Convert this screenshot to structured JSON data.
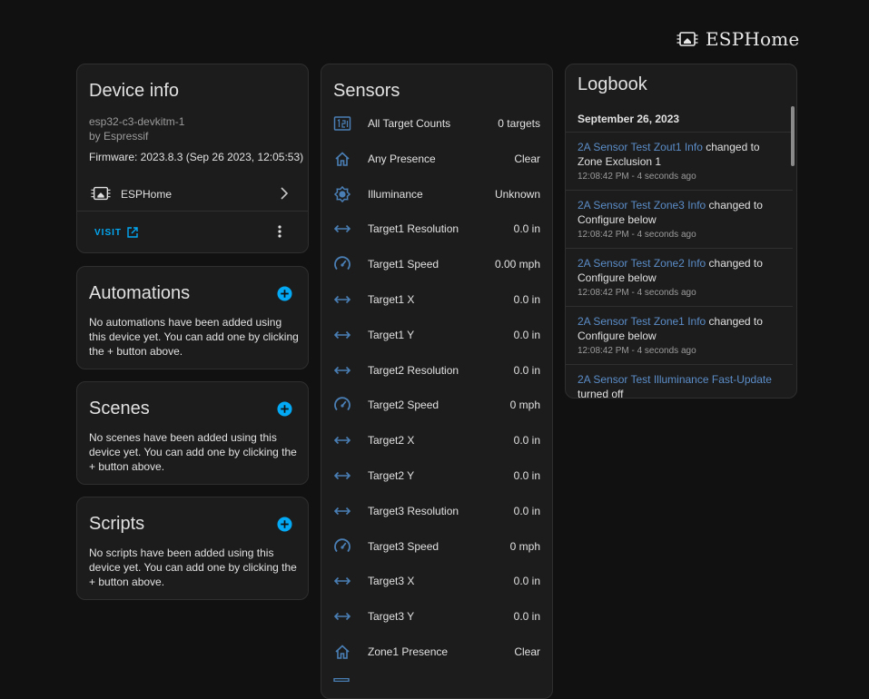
{
  "brand": {
    "name": "ESPHome"
  },
  "device_info": {
    "title": "Device info",
    "model": "esp32-c3-devkitm-1",
    "manufacturer": "by Espressif",
    "firmware": "Firmware: 2023.8.3 (Sep 26 2023, 12:05:53)",
    "integration": "ESPHome",
    "visit_label": "VISIT"
  },
  "automations": {
    "title": "Automations",
    "description": "No automations have been added using this device yet. You can add one by clicking the + button above."
  },
  "scenes": {
    "title": "Scenes",
    "description": "No scenes have been added using this device yet. You can add one by clicking the + button above."
  },
  "scripts": {
    "title": "Scripts",
    "description": "No scripts have been added using this device yet. You can add one by clicking the + button above."
  },
  "sensors": {
    "title": "Sensors",
    "items": [
      {
        "name": "All Target Counts",
        "value": "0 targets",
        "icon": "counter-icon"
      },
      {
        "name": "Any Presence",
        "value": "Clear",
        "icon": "home-icon"
      },
      {
        "name": "Illuminance",
        "value": "Unknown",
        "icon": "brightness-icon"
      },
      {
        "name": "Target1 Resolution",
        "value": "0.0 in",
        "icon": "arrow-left-right-icon"
      },
      {
        "name": "Target1 Speed",
        "value": "0.00 mph",
        "icon": "speedometer-icon"
      },
      {
        "name": "Target1 X",
        "value": "0.0 in",
        "icon": "arrow-left-right-icon"
      },
      {
        "name": "Target1 Y",
        "value": "0.0 in",
        "icon": "arrow-left-right-icon"
      },
      {
        "name": "Target2 Resolution",
        "value": "0.0 in",
        "icon": "arrow-left-right-icon"
      },
      {
        "name": "Target2 Speed",
        "value": "0 mph",
        "icon": "speedometer-icon"
      },
      {
        "name": "Target2 X",
        "value": "0.0 in",
        "icon": "arrow-left-right-icon"
      },
      {
        "name": "Target2 Y",
        "value": "0.0 in",
        "icon": "arrow-left-right-icon"
      },
      {
        "name": "Target3 Resolution",
        "value": "0.0 in",
        "icon": "arrow-left-right-icon"
      },
      {
        "name": "Target3 Speed",
        "value": "0 mph",
        "icon": "speedometer-icon"
      },
      {
        "name": "Target3 X",
        "value": "0.0 in",
        "icon": "arrow-left-right-icon"
      },
      {
        "name": "Target3 Y",
        "value": "0.0 in",
        "icon": "arrow-left-right-icon"
      },
      {
        "name": "Zone1 Presence",
        "value": "Clear",
        "icon": "home-icon"
      }
    ]
  },
  "logbook": {
    "title": "Logbook",
    "date": "September 26, 2023",
    "entries": [
      {
        "entity": "2A Sensor Test Zout1 Info",
        "action": " changed to Zone Exclusion 1",
        "time": "12:08:42 PM - 4 seconds ago"
      },
      {
        "entity": "2A Sensor Test Zone3 Info",
        "action": " changed to Configure below",
        "time": "12:08:42 PM - 4 seconds ago"
      },
      {
        "entity": "2A Sensor Test Zone2 Info",
        "action": " changed to Configure below",
        "time": "12:08:42 PM - 4 seconds ago"
      },
      {
        "entity": "2A Sensor Test Zone1 Info",
        "action": " changed to Configure below",
        "time": "12:08:42 PM - 4 seconds ago"
      },
      {
        "entity": "2A Sensor Test Illuminance Fast-Update",
        "action": " turned off",
        "time": ""
      }
    ]
  },
  "colors": {
    "accent": "#03a9f4",
    "icon": "#4a7fb5",
    "link": "#5b8dc8",
    "card": "#1c1c1c",
    "background": "#111111"
  }
}
